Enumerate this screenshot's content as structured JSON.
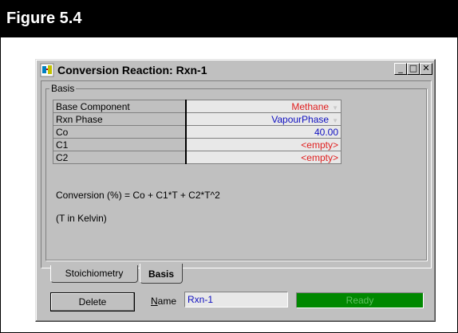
{
  "figure": {
    "label": "Figure 5.4"
  },
  "window": {
    "title": "Conversion Reaction: Rxn-1",
    "controls": {
      "minimize": "_",
      "maximize": "□",
      "close": "✕"
    }
  },
  "basis": {
    "group_label": "Basis",
    "rows": [
      {
        "label": "Base Component",
        "value": "Methane",
        "dropdown": true,
        "color": "#e02020"
      },
      {
        "label": "Rxn Phase",
        "value": "VapourPhase",
        "dropdown": true,
        "color": "#1010c0"
      },
      {
        "label": "Co",
        "value": "40.00",
        "dropdown": false,
        "color": "#1010c0"
      },
      {
        "label": "C1",
        "value": "<empty>",
        "dropdown": false,
        "color": "#e02020"
      },
      {
        "label": "C2",
        "value": "<empty>",
        "dropdown": false,
        "color": "#e02020"
      }
    ],
    "formula": "Conversion (%) = Co + C1*T + C2*T^2",
    "units_note": "(T in Kelvin)"
  },
  "tabs": [
    {
      "label": "Stoichiometry",
      "active": false
    },
    {
      "label": "Basis",
      "active": true
    }
  ],
  "footer": {
    "delete_label": "Delete",
    "name_label": "Name",
    "name_value": "Rxn-1",
    "status_text": "Ready",
    "status_color": "#008800"
  },
  "icons": {
    "app": "reactor-app-icon",
    "dropdown": "chevron-down-icon"
  }
}
